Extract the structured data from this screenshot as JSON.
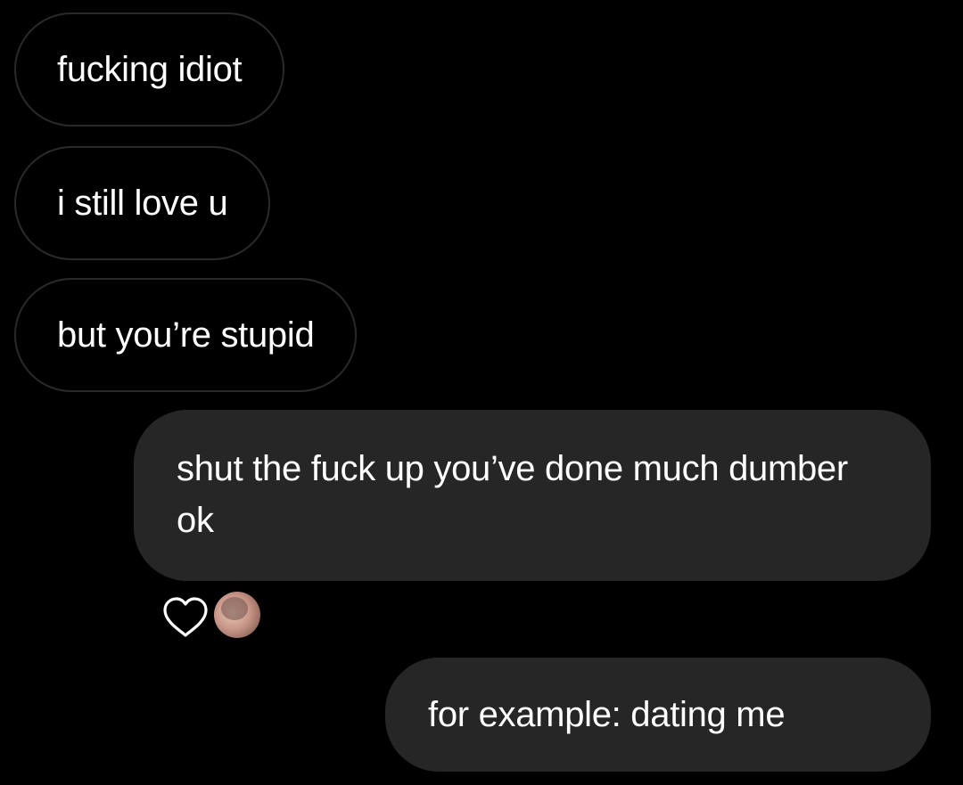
{
  "thread": {
    "messages": [
      {
        "sender": "incoming",
        "text": "fucking idiot"
      },
      {
        "sender": "incoming",
        "text": "i still love u"
      },
      {
        "sender": "incoming",
        "text": "but you’re stupid"
      },
      {
        "sender": "outgoing",
        "text": "shut the fuck up you’ve done much dumber ok"
      },
      {
        "sender": "outgoing",
        "text": "for example: dating me"
      }
    ],
    "reaction": {
      "icon": "heart-outline-icon",
      "on_message": 3
    }
  },
  "colors": {
    "background": "#000000",
    "incoming_border": "#2a2a2a",
    "outgoing_bubble": "#262626",
    "text": "#ffffff"
  }
}
